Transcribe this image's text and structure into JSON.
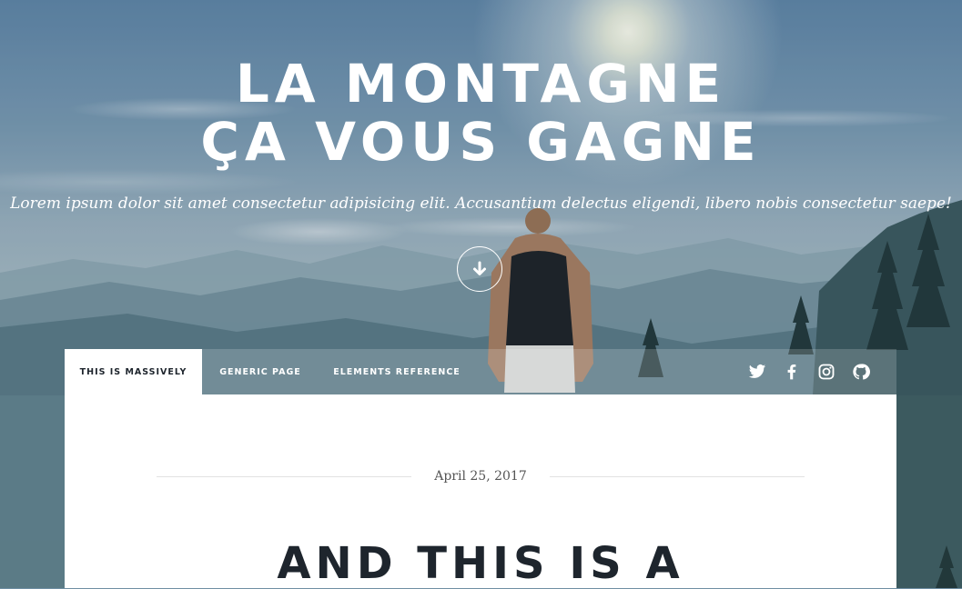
{
  "hero": {
    "title_line1": "LA MONTAGNE",
    "title_line2": "ÇA VOUS GAGNE",
    "subtitle": "Lorem ipsum dolor sit amet consectetur adipisicing elit. Accusantium delectus eligendi, libero nobis consectetur saepe!",
    "scroll_icon": "arrow-down-icon"
  },
  "nav": {
    "items": [
      {
        "label": "THIS IS MASSIVELY",
        "active": true
      },
      {
        "label": "GENERIC PAGE",
        "active": false
      },
      {
        "label": "ELEMENTS REFERENCE",
        "active": false
      }
    ],
    "social_icons": [
      "twitter-icon",
      "facebook-icon",
      "instagram-icon",
      "github-icon"
    ]
  },
  "post": {
    "date": "April 25, 2017",
    "title": "AND THIS IS A"
  },
  "colors": {
    "heading": "#1e252d",
    "panel": "#ffffff",
    "nav_text": "#ffffff"
  }
}
